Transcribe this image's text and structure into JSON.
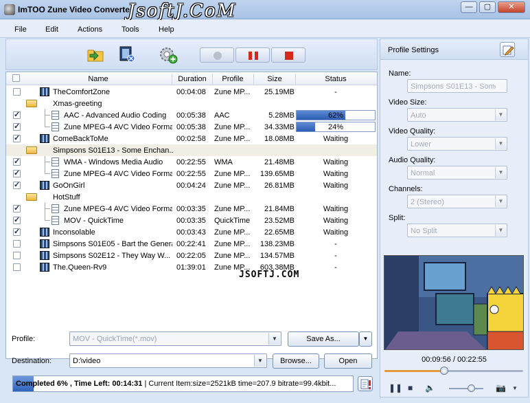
{
  "window": {
    "title": "ImTOO Zune Video Converte",
    "watermark_top": "JsoftJ.CoM",
    "minimize": "—",
    "maximize": "▢",
    "close": "✕"
  },
  "menu": [
    "File",
    "Edit",
    "Actions",
    "Tools",
    "Help"
  ],
  "list": {
    "headers": {
      "name": "Name",
      "duration": "Duration",
      "profile": "Profile",
      "size": "Size",
      "status": "Status"
    },
    "rows": [
      {
        "type": "file",
        "level": 0,
        "checked": false,
        "name": "TheComfortZone",
        "duration": "00:04:08",
        "profile": "Zune MP...",
        "size": "25.19MB",
        "status": "-"
      },
      {
        "type": "folder",
        "level": 0,
        "checked": null,
        "name": "Xmas-greeting"
      },
      {
        "type": "child",
        "level": 1,
        "checked": true,
        "name": "AAC - Advanced Audio Coding",
        "duration": "00:05:38",
        "profile": "AAC",
        "size": "5.28MB",
        "progress": 0.62,
        "status": "62%"
      },
      {
        "type": "child",
        "level": 1,
        "checked": true,
        "name": "Zune MPEG-4 AVC Video Format",
        "duration": "00:05:38",
        "profile": "Zune MP...",
        "size": "34.33MB",
        "progress": 0.24,
        "status": "24%"
      },
      {
        "type": "file",
        "level": 0,
        "checked": true,
        "name": "ComeBackToMe",
        "duration": "00:02:58",
        "profile": "Zune MP...",
        "size": "18.08MB",
        "status": "Waiting"
      },
      {
        "type": "folder",
        "level": 0,
        "checked": null,
        "selected": true,
        "name": "Simpsons S01E13 - Some Enchan..."
      },
      {
        "type": "child",
        "level": 1,
        "checked": true,
        "name": "WMA - Windows Media Audio",
        "duration": "00:22:55",
        "profile": "WMA",
        "size": "21.48MB",
        "status": "Waiting"
      },
      {
        "type": "child",
        "level": 1,
        "checked": true,
        "name": "Zune MPEG-4 AVC Video Format",
        "duration": "00:22:55",
        "profile": "Zune MP...",
        "size": "139.65MB",
        "status": "Waiting"
      },
      {
        "type": "file",
        "level": 0,
        "checked": true,
        "name": "GoOnGirl",
        "duration": "00:04:24",
        "profile": "Zune MP...",
        "size": "26.81MB",
        "status": "Waiting"
      },
      {
        "type": "folder",
        "level": 0,
        "checked": null,
        "name": "HotStuff"
      },
      {
        "type": "child",
        "level": 1,
        "checked": true,
        "name": "Zune MPEG-4 AVC Video Format",
        "duration": "00:03:35",
        "profile": "Zune MP...",
        "size": "21.84MB",
        "status": "Waiting"
      },
      {
        "type": "child",
        "level": 1,
        "checked": true,
        "name": "MOV - QuickTime",
        "duration": "00:03:35",
        "profile": "QuickTime",
        "size": "23.52MB",
        "status": "Waiting"
      },
      {
        "type": "file",
        "level": 0,
        "checked": true,
        "name": "Inconsolable",
        "duration": "00:03:43",
        "profile": "Zune MP...",
        "size": "22.65MB",
        "status": "Waiting"
      },
      {
        "type": "file",
        "level": 0,
        "checked": false,
        "name": "Simpsons S01E05 - Bart the General",
        "duration": "00:22:41",
        "profile": "Zune MP...",
        "size": "138.23MB",
        "status": "-"
      },
      {
        "type": "file",
        "level": 0,
        "checked": false,
        "name": "Simpsons S02E12 - They Way W...",
        "duration": "00:22:05",
        "profile": "Zune MP...",
        "size": "134.57MB",
        "status": "-"
      },
      {
        "type": "file",
        "level": 0,
        "checked": false,
        "name": "The.Queen-Rv9",
        "duration": "01:39:01",
        "profile": "Zune MP...",
        "size": "603.38MB",
        "status": "-"
      }
    ]
  },
  "mid_watermark": "JSOFTJ.COM",
  "form": {
    "profile_label": "Profile:",
    "profile_value": "MOV - QuickTime(*.mov)",
    "save_as": "Save As...",
    "destination_label": "Destination:",
    "destination_value": "D:\\video",
    "browse": "Browse...",
    "open": "Open"
  },
  "status": {
    "bold": "Completed 6% , Time Left: 00:14:31",
    "rest": " | Current Item:size=2521kB time=207.9 bitrate=99.4kbit...",
    "progress": 0.06
  },
  "profile_settings": {
    "title": "Profile Settings",
    "fields": [
      {
        "label": "Name:",
        "value": "Simpsons S01E13 - Some Ench",
        "dropdown": false
      },
      {
        "label": "Video Size:",
        "value": "Auto",
        "dropdown": true
      },
      {
        "label": "Video Quality:",
        "value": "Lower",
        "dropdown": true
      },
      {
        "label": "Audio Quality:",
        "value": "Normal",
        "dropdown": true
      },
      {
        "label": "Channels:",
        "value": "2 (Stereo)",
        "dropdown": true
      },
      {
        "label": "Split:",
        "value": "No Split",
        "dropdown": true
      }
    ]
  },
  "player": {
    "time": "00:09:56 / 00:22:55",
    "seek_progress": 0.43
  },
  "colors": {
    "accent": "#2c5db3",
    "selected_row": "#f0eee5",
    "record": "#d42a1e"
  }
}
